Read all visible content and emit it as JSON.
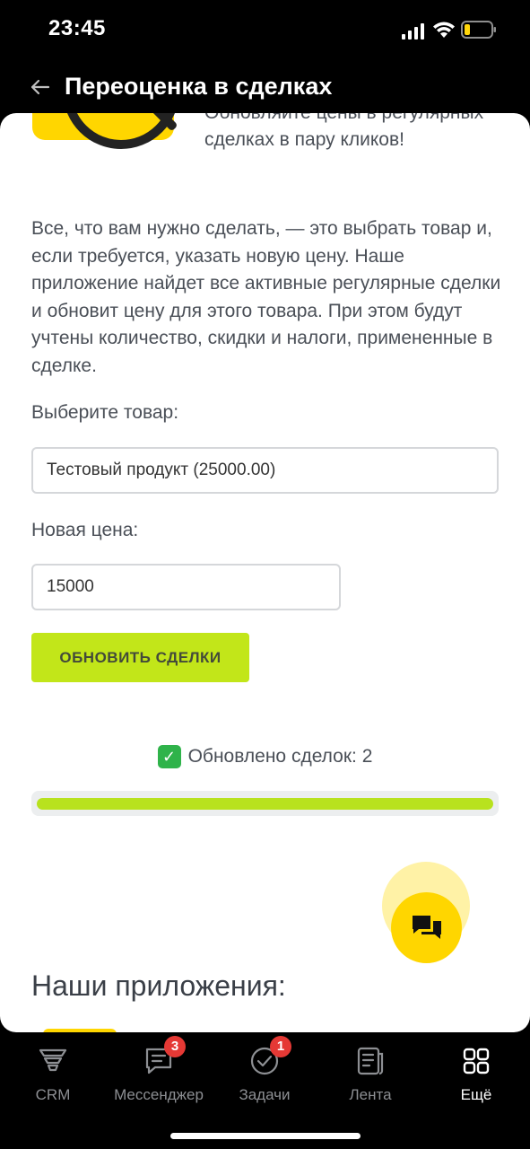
{
  "status_bar": {
    "time": "23:45"
  },
  "nav": {
    "title": "Переоценка в сделках"
  },
  "hero": {
    "text": "Обновляйте цены в регулярных сделках в пару кликов!"
  },
  "description": "Все, что вам нужно сделать, — это выбрать товар и, если требуется, указать новую цену. Наше приложение найдет все активные регулярные сделки и обновит цену для этого товара. При этом будут учтены количество, скидки и налоги, примененные в сделке.",
  "form": {
    "product_label": "Выберите товар:",
    "product_value": "Тестовый продукт (25000.00)",
    "price_label": "Новая цена:",
    "price_value": "15000",
    "submit_label": "ОБНОВИТЬ СДЕЛКИ"
  },
  "result": {
    "text": "Обновлено сделок: 2",
    "icon": "check-mark-icon",
    "progress": 1.0
  },
  "apps": {
    "title": "Наши приложения:"
  },
  "tabbar": {
    "tabs": [
      {
        "label": "CRM",
        "icon": "crm-icon",
        "badge": ""
      },
      {
        "label": "Мессенджер",
        "icon": "chat-icon",
        "badge": "3"
      },
      {
        "label": "Задачи",
        "icon": "check-circle-icon",
        "badge": "1"
      },
      {
        "label": "Лента",
        "icon": "feed-icon",
        "badge": ""
      },
      {
        "label": "Ещё",
        "icon": "grid-icon",
        "badge": ""
      }
    ],
    "active": "Ещё"
  },
  "colors": {
    "accent": "#c2e619",
    "brand_yellow": "#ffd600",
    "badge_red": "#e53935"
  }
}
